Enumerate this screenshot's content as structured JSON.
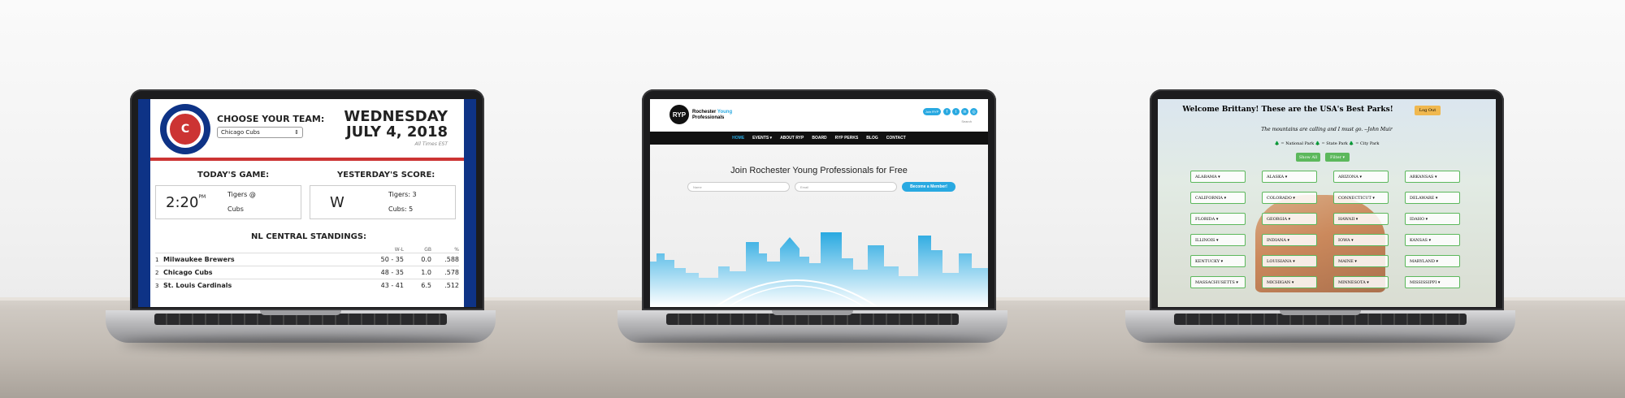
{
  "cubs_site": {
    "choose_label": "CHOOSE YOUR TEAM:",
    "selected_team": "Chicago Cubs",
    "day": "WEDNESDAY",
    "date": "JULY 4, 2018",
    "timezone_note": "All Times EST",
    "todays_game_heading": "TODAY'S GAME:",
    "game_time": "2:20",
    "game_time_suffix": "PM",
    "away_team": "Tigers @",
    "home_team": "Cubs",
    "yesterday_heading": "YESTERDAY'S SCORE:",
    "result": "W",
    "score_line_1": "Tigers: 3",
    "score_line_2": "Cubs: 5",
    "standings_heading": "NL CENTRAL STANDINGS:",
    "standings_headers": [
      "W-L",
      "GB",
      "%"
    ],
    "standings": [
      {
        "rank": "1",
        "team": "Milwaukee Brewers",
        "wl": "50 - 35",
        "gb": "0.0",
        "pct": ".588"
      },
      {
        "rank": "2",
        "team": "Chicago Cubs",
        "wl": "48 - 35",
        "gb": "1.0",
        "pct": ".578"
      },
      {
        "rank": "3",
        "team": "St. Louis Cardinals",
        "wl": "43 - 41",
        "gb": "6.5",
        "pct": ".512"
      }
    ],
    "colors": {
      "navy": "#0e3386",
      "red": "#cc3433"
    }
  },
  "ryp_site": {
    "logo_text": "RYP",
    "name_line_1": "Rochester",
    "name_line_1_accent": "Young",
    "name_line_2": "Professionals",
    "join_label": "Join RYP",
    "social_icons": [
      "facebook-icon",
      "twitter-icon",
      "linkedin-icon",
      "instagram-icon"
    ],
    "search_label": "Search",
    "nav": [
      "HOME",
      "EVENTS ▾",
      "ABOUT RYP",
      "BOARD",
      "RYP PERKS",
      "BLOG",
      "CONTACT"
    ],
    "hero_title": "Join Rochester Young Professionals for Free",
    "name_placeholder": "Name",
    "email_placeholder": "Email",
    "cta": "Become a Member!",
    "accent": "#29a9e1"
  },
  "parks_site": {
    "welcome": "Welcome Brittany! These are the USA's Best Parks!",
    "logout": "Log Out",
    "quote": "The mountains are calling and I must go. --John Muir",
    "legend": "🌲 = National Park 🌲 = State Park 🌲 = City Park",
    "show_all": "Show All",
    "filter": "Filter ▾",
    "states": [
      "ALABAMA ▾",
      "ALASKA ▾",
      "ARIZONA ▾",
      "ARKANSAS ▾",
      "CALIFORNIA ▾",
      "COLORADO ▾",
      "CONNECTICUT ▾",
      "DELAWARE ▾",
      "FLORIDA ▾",
      "GEORGIA ▾",
      "HAWAII ▾",
      "IDAHO ▾",
      "ILLINOIS ▾",
      "INDIANA ▾",
      "IOWA ▾",
      "KANSAS ▾",
      "KENTUCKY ▾",
      "LOUISIANA ▾",
      "MAINE ▾",
      "MARYLAND ▾",
      "MASSACHUSETTS ▾",
      "MICHIGAN ▾",
      "MINNESOTA ▾",
      "MISSISSIPPI ▾"
    ],
    "accent": "#5cb85c"
  }
}
